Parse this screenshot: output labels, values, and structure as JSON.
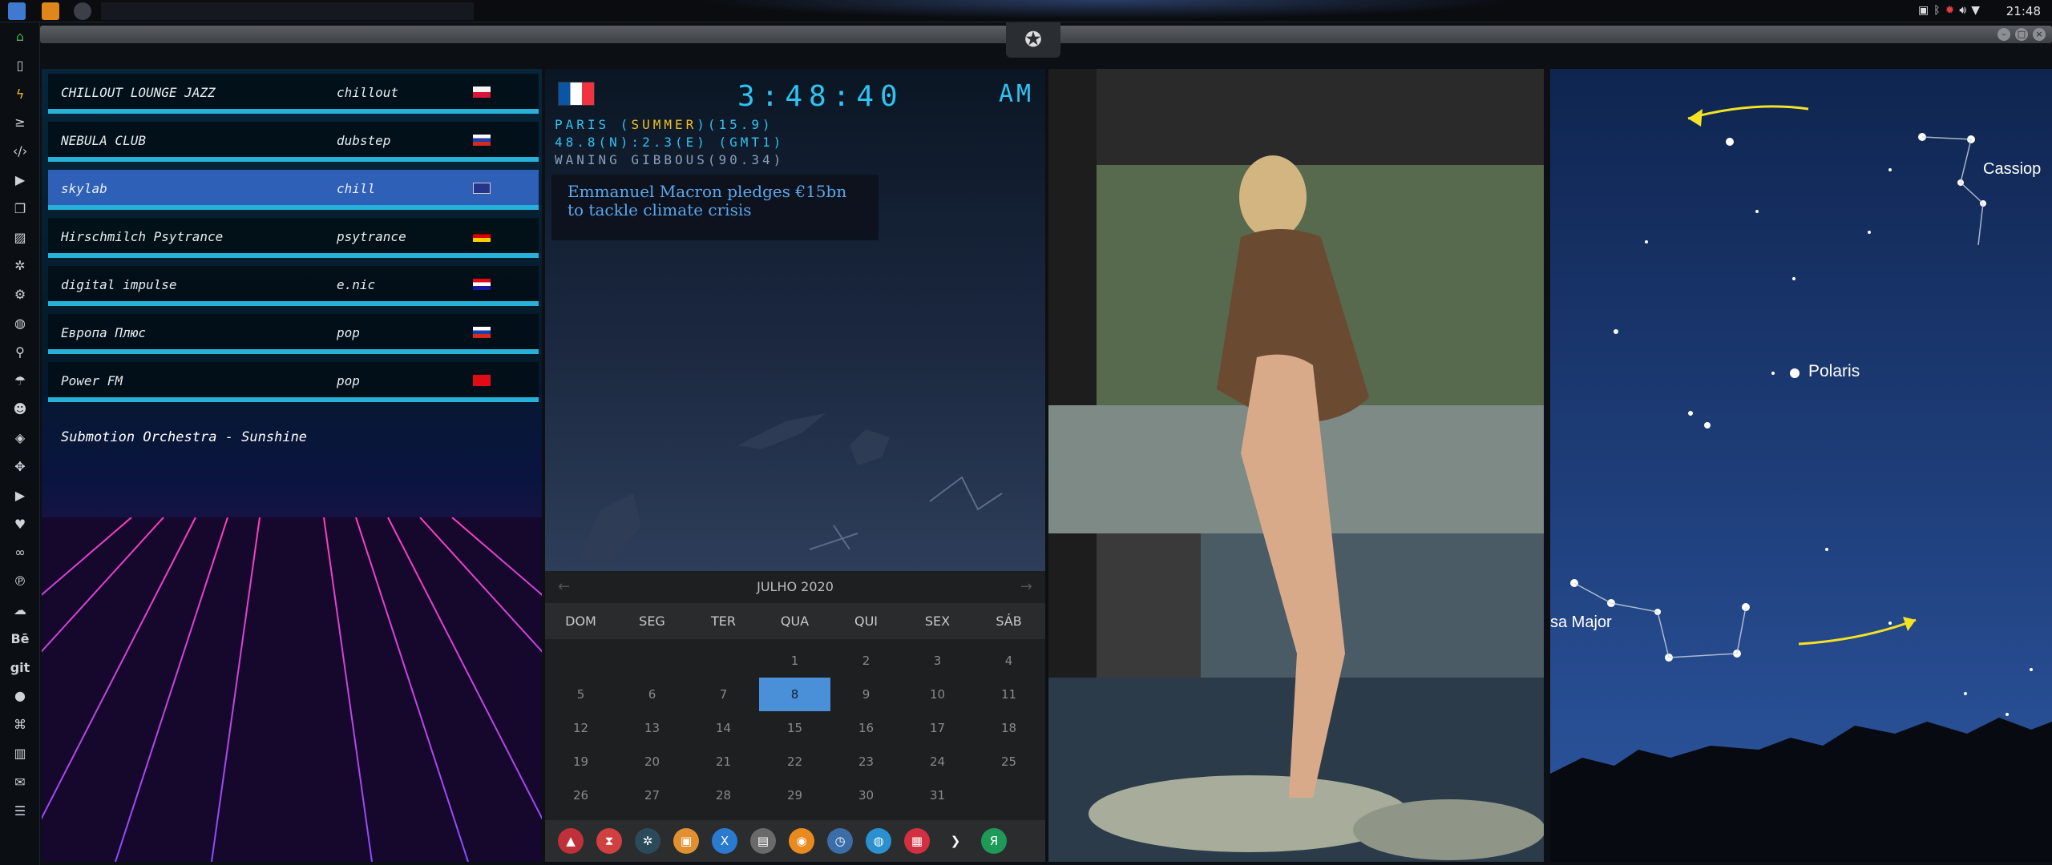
{
  "topbar": {
    "clock": "21:48",
    "tray_icons": [
      "image-icon",
      "bluetooth-icon",
      "alert-icon",
      "volume-icon",
      "wifi-icon"
    ]
  },
  "titlebar": {
    "emblem_icon": "rebel-alliance-icon",
    "buttons": [
      "minimize",
      "maximize",
      "close"
    ]
  },
  "sidebar": {
    "icons": [
      "home-icon",
      "document-icon",
      "bolt-icon",
      "terminal-icon",
      "code-icon",
      "play-icon",
      "copy-icon",
      "image-icon",
      "aperture-icon",
      "gear-icon",
      "globe-icon",
      "search-icon",
      "umbrella-icon",
      "contact-icon",
      "tag-icon",
      "expand-icon",
      "youtube-icon",
      "heart-icon",
      "lastfm-icon",
      "pinterest-icon",
      "cloud-icon",
      "behance-icon",
      "git-icon",
      "github-icon",
      "pocket-icon",
      "map-icon",
      "mail-icon",
      "stack-icon"
    ],
    "text_icons": {
      "behance": "Bē",
      "git": "git"
    }
  },
  "radio": {
    "stations": [
      {
        "name": "CHILLOUT LOUNGE JAZZ",
        "genre": "chillout",
        "flag": "poland",
        "selected": false
      },
      {
        "name": "NEBULA CLUB",
        "genre": "dubstep",
        "flag": "russia",
        "selected": false
      },
      {
        "name": "skylab",
        "genre": "chill",
        "flag": "uk",
        "selected": true
      },
      {
        "name": "Hirschmilch Psytrance",
        "genre": "psytrance",
        "flag": "germany",
        "selected": false
      },
      {
        "name": "digital impulse",
        "genre": "e.nic",
        "flag": "croatia",
        "selected": false
      },
      {
        "name": "Европа Плюс",
        "genre": "pop",
        "flag": "russia",
        "selected": false
      },
      {
        "name": "Power FM",
        "genre": "pop",
        "flag": "turkey",
        "selected": false
      }
    ],
    "now_playing": "Submotion Orchestra - Sunshine"
  },
  "clock_widget": {
    "flag": "france",
    "time": "3:48:40",
    "ampm": "AM",
    "line1_prefix": "PARIS (",
    "line1_highlight": "SUMMER",
    "line1_suffix": ")(15.9)",
    "line2": "48.8(N):2.3(E) (GMT1)",
    "line3": "WANING GIBBOUS(90.34)",
    "news": "Emmanuel Macron pledges €15bn to tackle climate crisis"
  },
  "calendar": {
    "month": "JULHO 2020",
    "weekdays": [
      "DOM",
      "SEG",
      "TER",
      "QUA",
      "QUI",
      "SEX",
      "SÁB"
    ],
    "weeks": [
      [
        "",
        "",
        "",
        "1",
        "2",
        "3",
        "4"
      ],
      [
        "5",
        "6",
        "7",
        "8",
        "9",
        "10",
        "11"
      ],
      [
        "12",
        "13",
        "14",
        "15",
        "16",
        "17",
        "18"
      ],
      [
        "19",
        "20",
        "21",
        "22",
        "23",
        "24",
        "25"
      ],
      [
        "26",
        "27",
        "28",
        "29",
        "30",
        "31",
        ""
      ]
    ],
    "today": "8"
  },
  "dock": {
    "apps": [
      {
        "icon": "arch-icon",
        "glyph": "▲",
        "color": "#c0303a"
      },
      {
        "icon": "hourglass-icon",
        "glyph": "⧗",
        "color": "#d04040"
      },
      {
        "icon": "gear-app-icon",
        "glyph": "✲",
        "color": "#2b4a5a"
      },
      {
        "icon": "image-viewer-icon",
        "glyph": "▣",
        "color": "#e09030"
      },
      {
        "icon": "translate-icon",
        "glyph": "X",
        "color": "#2a7ad0"
      },
      {
        "icon": "window-icon",
        "glyph": "▤",
        "color": "#6a6a6a"
      },
      {
        "icon": "search-app-icon",
        "glyph": "◉",
        "color": "#e88a20"
      },
      {
        "icon": "clock-app-icon",
        "glyph": "◷",
        "color": "#3b6ea8"
      },
      {
        "icon": "globe-app-icon",
        "glyph": "◍",
        "color": "#2a90d0"
      },
      {
        "icon": "calendar-app-icon",
        "glyph": "▦",
        "color": "#d03040"
      },
      {
        "icon": "arrow-app-icon",
        "glyph": "❯",
        "color": "#2b2c2e"
      },
      {
        "icon": "yandex-icon",
        "glyph": "Я",
        "color": "#1e9a58"
      }
    ]
  },
  "starmap": {
    "labels": {
      "cassiopeia": "Cassiop",
      "polaris": "Polaris",
      "ursa": "sa Major"
    },
    "accent": "#f4e224"
  }
}
